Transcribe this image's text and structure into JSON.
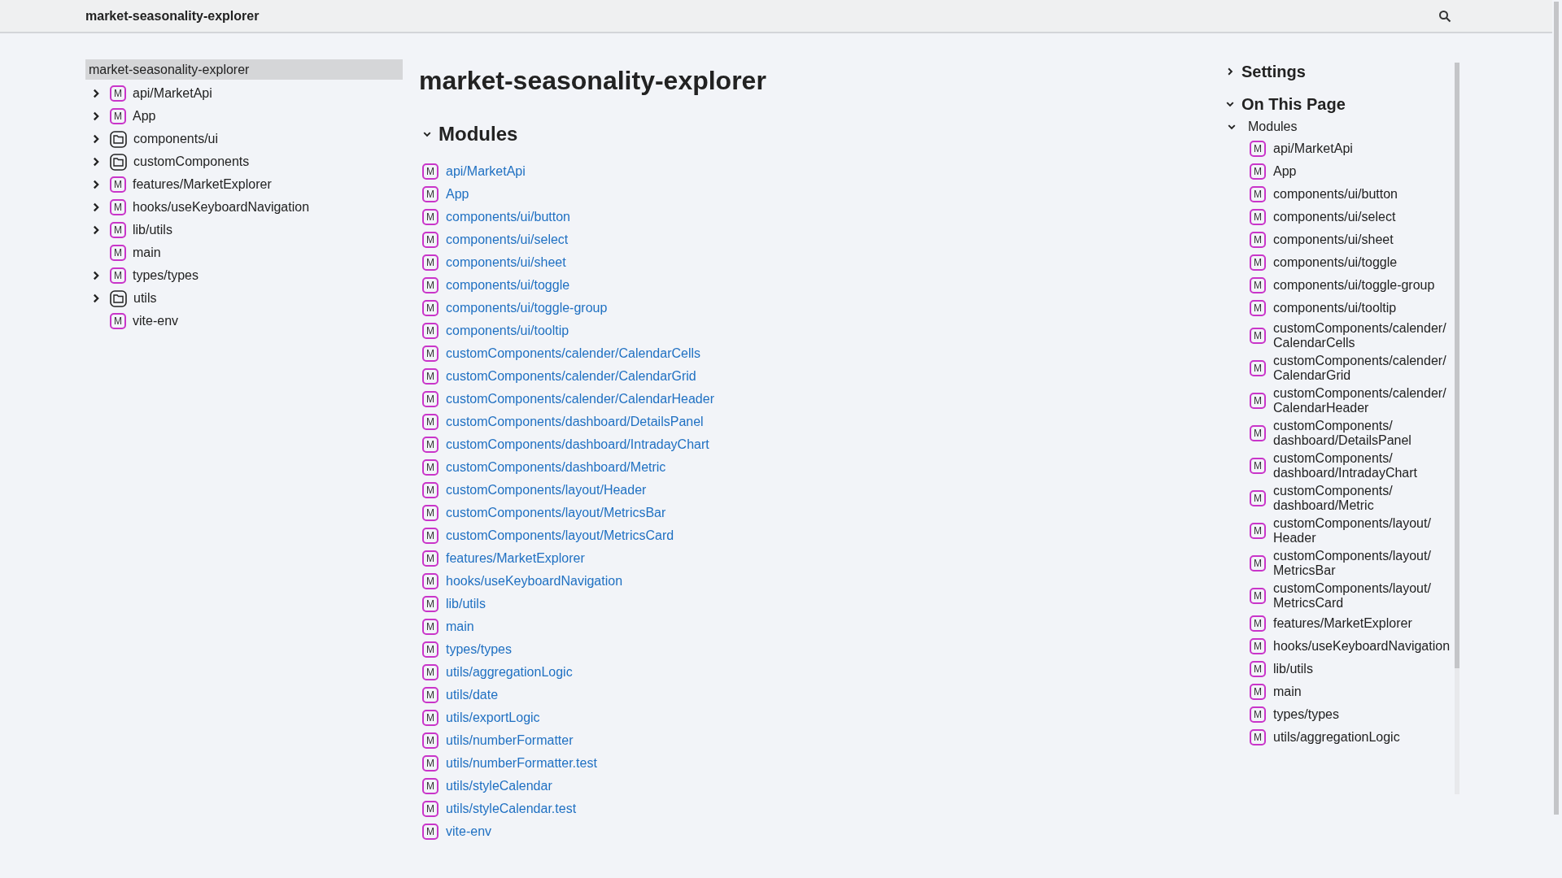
{
  "header": {
    "title": "market-seasonality-explorer"
  },
  "sidebar": {
    "items": [
      {
        "label": "market-seasonality-explorer",
        "kind": "root",
        "selected": true
      },
      {
        "label": "api/MarketApi",
        "kind": "module",
        "badge": "M",
        "selected": false,
        "expandable": true
      },
      {
        "label": "App",
        "kind": "module",
        "badge": "M",
        "selected": false,
        "expandable": true
      },
      {
        "label": "components/ui",
        "kind": "folder",
        "selected": false,
        "expandable": true
      },
      {
        "label": "customComponents",
        "kind": "folder",
        "selected": false,
        "expandable": true
      },
      {
        "label": "features/MarketExplorer",
        "kind": "module",
        "badge": "M",
        "selected": false,
        "expandable": true
      },
      {
        "label": "hooks/useKeyboardNavigation",
        "kind": "module",
        "badge": "M",
        "selected": false,
        "expandable": true
      },
      {
        "label": "lib/utils",
        "kind": "module",
        "badge": "M",
        "selected": false,
        "expandable": true
      },
      {
        "label": "main",
        "kind": "module",
        "badge": "M",
        "selected": false,
        "expandable": false
      },
      {
        "label": "types/types",
        "kind": "module",
        "badge": "M",
        "selected": false,
        "expandable": true
      },
      {
        "label": "utils",
        "kind": "folder",
        "selected": false,
        "expandable": true
      },
      {
        "label": "vite-env",
        "kind": "module",
        "badge": "M",
        "selected": false,
        "expandable": false
      }
    ]
  },
  "main": {
    "title": "market-seasonality-explorer",
    "section": {
      "title": "Modules",
      "expanded": true,
      "items": [
        {
          "badge": "M",
          "label": "api/MarketApi"
        },
        {
          "badge": "M",
          "label": "App"
        },
        {
          "badge": "M",
          "label": "components/ui/button"
        },
        {
          "badge": "M",
          "label": "components/ui/select"
        },
        {
          "badge": "M",
          "label": "components/ui/sheet"
        },
        {
          "badge": "M",
          "label": "components/ui/toggle"
        },
        {
          "badge": "M",
          "label": "components/ui/toggle-group"
        },
        {
          "badge": "M",
          "label": "components/ui/tooltip"
        },
        {
          "badge": "M",
          "label": "customComponents/calender/CalendarCells"
        },
        {
          "badge": "M",
          "label": "customComponents/calender/CalendarGrid"
        },
        {
          "badge": "M",
          "label": "customComponents/calender/CalendarHeader"
        },
        {
          "badge": "M",
          "label": "customComponents/dashboard/DetailsPanel"
        },
        {
          "badge": "M",
          "label": "customComponents/dashboard/IntradayChart"
        },
        {
          "badge": "M",
          "label": "customComponents/dashboard/Metric"
        },
        {
          "badge": "M",
          "label": "customComponents/layout/Header"
        },
        {
          "badge": "M",
          "label": "customComponents/layout/MetricsBar"
        },
        {
          "badge": "M",
          "label": "customComponents/layout/MetricsCard"
        },
        {
          "badge": "M",
          "label": "features/MarketExplorer"
        },
        {
          "badge": "M",
          "label": "hooks/useKeyboardNavigation"
        },
        {
          "badge": "M",
          "label": "lib/utils"
        },
        {
          "badge": "M",
          "label": "main"
        },
        {
          "badge": "M",
          "label": "types/types"
        },
        {
          "badge": "M",
          "label": "utils/aggregationLogic"
        },
        {
          "badge": "M",
          "label": "utils/date"
        },
        {
          "badge": "M",
          "label": "utils/exportLogic"
        },
        {
          "badge": "M",
          "label": "utils/numberFormatter"
        },
        {
          "badge": "M",
          "label": "utils/numberFormatter.test"
        },
        {
          "badge": "M",
          "label": "utils/styleCalendar"
        },
        {
          "badge": "M",
          "label": "utils/styleCalendar.test"
        },
        {
          "badge": "M",
          "label": "vite-env"
        }
      ]
    }
  },
  "toc": {
    "settings": {
      "title": "Settings",
      "expanded": false
    },
    "on_this_page": {
      "title": "On This Page",
      "expanded": true,
      "group": {
        "title": "Modules",
        "expanded": true,
        "items": [
          {
            "badge": "M",
            "label": "api/MarketApi"
          },
          {
            "badge": "M",
            "label": "App"
          },
          {
            "badge": "M",
            "label": "components/ui/button"
          },
          {
            "badge": "M",
            "label": "components/ui/select"
          },
          {
            "badge": "M",
            "label": "components/ui/sheet"
          },
          {
            "badge": "M",
            "label": "components/ui/toggle"
          },
          {
            "badge": "M",
            "label": "components/ui/toggle-group"
          },
          {
            "badge": "M",
            "label": "components/ui/tooltip"
          },
          {
            "badge": "M",
            "label": "customComponents/calender/CalendarCells"
          },
          {
            "badge": "M",
            "label": "customComponents/calender/CalendarGrid"
          },
          {
            "badge": "M",
            "label": "customComponents/calender/CalendarHeader"
          },
          {
            "badge": "M",
            "label": "customComponents/dashboard/DetailsPanel"
          },
          {
            "badge": "M",
            "label": "customComponents/dashboard/IntradayChart"
          },
          {
            "badge": "M",
            "label": "customComponents/dashboard/Metric"
          },
          {
            "badge": "M",
            "label": "customComponents/layout/Header"
          },
          {
            "badge": "M",
            "label": "customComponents/layout/MetricsBar"
          },
          {
            "badge": "M",
            "label": "customComponents/layout/MetricsCard"
          },
          {
            "badge": "M",
            "label": "features/MarketExplorer"
          },
          {
            "badge": "M",
            "label": "hooks/useKeyboardNavigation"
          },
          {
            "badge": "M",
            "label": "lib/utils"
          },
          {
            "badge": "M",
            "label": "main"
          },
          {
            "badge": "M",
            "label": "types/types"
          },
          {
            "badge": "M",
            "label": "utils/aggregationLogic"
          }
        ]
      }
    }
  }
}
